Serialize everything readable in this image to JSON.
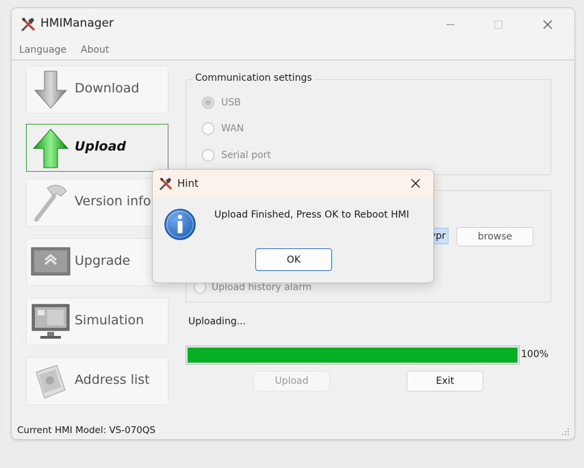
{
  "window": {
    "title": "HMIManager",
    "menu": [
      "Language",
      "About"
    ]
  },
  "sidebar": {
    "items": [
      {
        "label": "Download",
        "icon": "download-arrow-icon",
        "active": false
      },
      {
        "label": "Upload",
        "icon": "upload-arrow-icon",
        "active": true
      },
      {
        "label": "Version info",
        "icon": "hammer-icon",
        "active": false
      },
      {
        "label": "Upgrade",
        "icon": "upgrade-screen-icon",
        "active": false
      },
      {
        "label": "Simulation",
        "icon": "monitor-icon",
        "active": false
      },
      {
        "label": "Address list",
        "icon": "address-book-icon",
        "active": false
      }
    ]
  },
  "communication": {
    "legend": "Communication settings",
    "options": [
      "USB",
      "WAN",
      "Serial port"
    ],
    "selected": "USB"
  },
  "upload_options": {
    "file_fragment": "ypr",
    "browse_label": "browse",
    "history_alarm_label": "Upload history alarm"
  },
  "progress": {
    "status_text": "Uploading...",
    "percent_label": "100%",
    "value": 100
  },
  "buttons": {
    "upload": "Upload",
    "exit": "Exit"
  },
  "status_bar": {
    "model_text": "Current HMI Model: VS-070QS"
  },
  "dialog": {
    "title": "Hint",
    "message": "Upload Finished, Press OK to Reboot HMI",
    "ok_label": "OK",
    "icon": "info-icon"
  },
  "colors": {
    "progress_fill": "#06b025",
    "active_border": "#3c9a3c",
    "info_blue": "#1f5fb8",
    "ok_border": "#2a6fbf"
  }
}
